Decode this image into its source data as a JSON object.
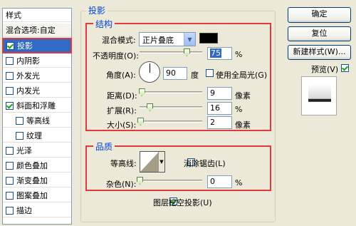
{
  "left_panel": {
    "title": "样式",
    "items": [
      {
        "label": "混合选项:自定",
        "checkbox": false
      },
      {
        "label": "投影",
        "checkbox": true,
        "checked": true,
        "selected": true
      },
      {
        "label": "内阴影",
        "checkbox": true,
        "checked": false
      },
      {
        "label": "外发光",
        "checkbox": true,
        "checked": false
      },
      {
        "label": "内发光",
        "checkbox": true,
        "checked": false
      },
      {
        "label": "斜面和浮雕",
        "checkbox": true,
        "checked": true
      },
      {
        "label": "等高线",
        "checkbox": true,
        "checked": false,
        "indent": true
      },
      {
        "label": "纹理",
        "checkbox": true,
        "checked": false,
        "indent": true
      },
      {
        "label": "光泽",
        "checkbox": true,
        "checked": false
      },
      {
        "label": "颜色叠加",
        "checkbox": true,
        "checked": false
      },
      {
        "label": "渐变叠加",
        "checkbox": true,
        "checked": false
      },
      {
        "label": "图案叠加",
        "checkbox": true,
        "checked": false
      },
      {
        "label": "描边",
        "checkbox": true,
        "checked": false
      }
    ]
  },
  "section_title": "投影",
  "structure": {
    "title": "结构",
    "blend_mode_label": "混合模式:",
    "blend_mode_value": "正片叠底",
    "blend_color": "#000000",
    "opacity_label": "不透明度(O):",
    "opacity_value": "75",
    "opacity_unit": "%",
    "opacity_fraction": 0.75,
    "angle_label": "角度(A):",
    "angle_value": "90",
    "angle_unit": "度",
    "global_light_label": "使用全局光(G)",
    "distance_label": "距离(D):",
    "distance_value": "9",
    "distance_unit": "像素",
    "distance_fraction": 0.03,
    "spread_label": "扩展(R):",
    "spread_value": "16",
    "spread_unit": "%",
    "spread_fraction": 0.16,
    "size_label": "大小(S):",
    "size_value": "2",
    "size_unit": "像素",
    "size_fraction": 0.01
  },
  "quality": {
    "title": "品质",
    "contour_label": "等高线:",
    "anti_alias_label": "消除锯齿(L)",
    "noise_label": "杂色(N):",
    "noise_value": "0",
    "noise_unit": "%",
    "noise_fraction": 0
  },
  "knockout_label": "图层挖空投影(U)",
  "buttons": {
    "ok": "确定",
    "reset": "复位",
    "new_style": "新建样式(W)...",
    "preview": "预览(V)"
  },
  "colors": {
    "accent_red": "#e23a3a",
    "title_blue": "#0046d5",
    "selection_blue": "#3169c6"
  }
}
